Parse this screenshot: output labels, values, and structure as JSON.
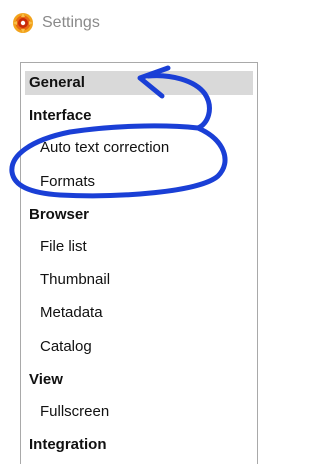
{
  "window": {
    "title": "Settings",
    "icon": "settings-app-icon"
  },
  "tree": {
    "items": [
      {
        "label": "General",
        "level": 0,
        "selected": true
      },
      {
        "label": "Interface",
        "level": 0,
        "selected": false
      },
      {
        "label": "Auto text correction",
        "level": 1,
        "selected": false
      },
      {
        "label": "Formats",
        "level": 1,
        "selected": false
      },
      {
        "label": "Browser",
        "level": 0,
        "selected": false
      },
      {
        "label": "File list",
        "level": 1,
        "selected": false
      },
      {
        "label": "Thumbnail",
        "level": 1,
        "selected": false
      },
      {
        "label": "Metadata",
        "level": 1,
        "selected": false
      },
      {
        "label": "Catalog",
        "level": 1,
        "selected": false
      },
      {
        "label": "View",
        "level": 0,
        "selected": false
      },
      {
        "label": "Fullscreen",
        "level": 1,
        "selected": false
      },
      {
        "label": "Integration",
        "level": 0,
        "selected": false
      }
    ]
  },
  "colors": {
    "annotation": "#1a3fd6",
    "selection": "#d9d9d9",
    "border": "#a9a9a9"
  }
}
